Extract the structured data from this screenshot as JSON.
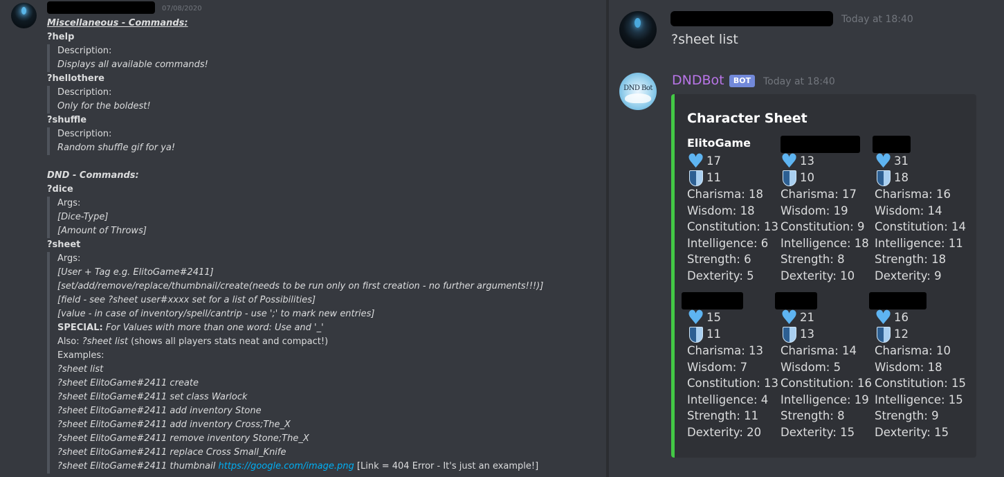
{
  "left": {
    "timestamp": "07/08/2020",
    "lines": [
      {
        "type": "section",
        "text": "Miscellaneous - Commands:"
      },
      {
        "type": "cmd",
        "text": "?help"
      },
      {
        "type": "q",
        "text": "Description:"
      },
      {
        "type": "q-it",
        "text": "Displays all available commands!"
      },
      {
        "type": "cmd",
        "text": "?hellothere"
      },
      {
        "type": "q",
        "text": "Description:"
      },
      {
        "type": "q-it",
        "text": "Only for the boldest!"
      },
      {
        "type": "cmd",
        "text": "?shuffle"
      },
      {
        "type": "q",
        "text": "Description:"
      },
      {
        "type": "q-it",
        "text": "Random shuffle gif for ya!"
      },
      {
        "type": "blank",
        "text": ""
      },
      {
        "type": "section-plain",
        "text": "DND - Commands:"
      },
      {
        "type": "cmd",
        "text": "?dice"
      },
      {
        "type": "q",
        "text": "Args:"
      },
      {
        "type": "q-it",
        "text": "[Dice-Type]"
      },
      {
        "type": "q-it",
        "text": "[Amount of Throws]"
      },
      {
        "type": "cmd",
        "text": "?sheet"
      },
      {
        "type": "q",
        "text": "Args:"
      },
      {
        "type": "q-it",
        "text": "[User + Tag e.g. ElitoGame#2411]"
      },
      {
        "type": "q-it",
        "text": "[set/add/remove/replace/thumbnail/create(needs to be run only on first creation - no further arguments!!!)]"
      },
      {
        "type": "q-it",
        "text": "[field - see ?sheet user#xxxx set for a list of Possibilities]"
      },
      {
        "type": "q-it",
        "text": "[value - in case of inventory/spell/cantrip - use ';' to mark new entries]"
      },
      {
        "type": "q-special",
        "label": "SPECIAL:",
        "text": " For Values with more than one word: Use and '_'"
      },
      {
        "type": "q-also",
        "label": "Also: ",
        "cmd": "?sheet list",
        "text": " (shows all players stats neat and compact!)"
      },
      {
        "type": "q",
        "text": "Examples:"
      },
      {
        "type": "q-it",
        "text": "?sheet list"
      },
      {
        "type": "q-it",
        "text": "?sheet ElitoGame#2411 create"
      },
      {
        "type": "q-it",
        "text": "?sheet ElitoGame#2411 set class Warlock"
      },
      {
        "type": "q-it",
        "text": "?sheet ElitoGame#2411 add inventory Stone"
      },
      {
        "type": "q-it",
        "text": "?sheet ElitoGame#2411 add inventory Cross;The_X"
      },
      {
        "type": "q-it",
        "text": "?sheet ElitoGame#2411 remove inventory Stone;The_X"
      },
      {
        "type": "q-it",
        "text": "?sheet ElitoGame#2411 replace Cross Small_Knife"
      },
      {
        "type": "q-link",
        "text": "?sheet ElitoGame#2411 thumbnail ",
        "link": "https://google.com/image.png",
        "tail": " [Link = 404 Error - It's just an example!]"
      }
    ]
  },
  "right": {
    "user_timestamp": "Today at 18:40",
    "user_message": "?sheet list",
    "bot_avatar_text": "DND Bot",
    "bot_name": "DNDBot",
    "bot_badge": "BOT",
    "bot_timestamp": "Today at 18:40",
    "embed": {
      "accent_color": "#43c845",
      "title": "Character Sheet",
      "players": [
        {
          "name": "ElitoGame",
          "hp": "17",
          "ac": "11",
          "charisma": "Charisma: 18",
          "wisdom": "Wisdom: 18",
          "constitution": "Constitution: 13",
          "intelligence": "Intelligence: 6",
          "strength": "Strength: 6",
          "dexterity": "Dexterity: 5"
        },
        {
          "name": "",
          "hp": "13",
          "ac": "10",
          "charisma": "Charisma: 17",
          "wisdom": "Wisdom: 19",
          "constitution": "Constitution: 9",
          "intelligence": "Intelligence: 18",
          "strength": "Strength: 8",
          "dexterity": "Dexterity: 10"
        },
        {
          "name": "",
          "hp": "31",
          "ac": "18",
          "charisma": "Charisma: 16",
          "wisdom": "Wisdom: 14",
          "constitution": "Constitution: 14",
          "intelligence": "Intelligence: 11",
          "strength": "Strength: 18",
          "dexterity": "Dexterity: 9"
        },
        {
          "name": "",
          "hp": "15",
          "ac": "11",
          "charisma": "Charisma: 13",
          "wisdom": "Wisdom: 7",
          "constitution": "Constitution: 13",
          "intelligence": "Intelligence: 4",
          "strength": "Strength: 11",
          "dexterity": "Dexterity: 20"
        },
        {
          "name": "",
          "hp": "21",
          "ac": "13",
          "charisma": "Charisma: 14",
          "wisdom": "Wisdom: 5",
          "constitution": "Constitution: 16",
          "intelligence": "Intelligence: 19",
          "strength": "Strength: 8",
          "dexterity": "Dexterity: 15"
        },
        {
          "name": "",
          "hp": "16",
          "ac": "12",
          "charisma": "Charisma: 10",
          "wisdom": "Wisdom: 18",
          "constitution": "Constitution: 15",
          "intelligence": "Intelligence: 15",
          "strength": "Strength: 9",
          "dexterity": "Dexterity: 15"
        }
      ]
    }
  }
}
